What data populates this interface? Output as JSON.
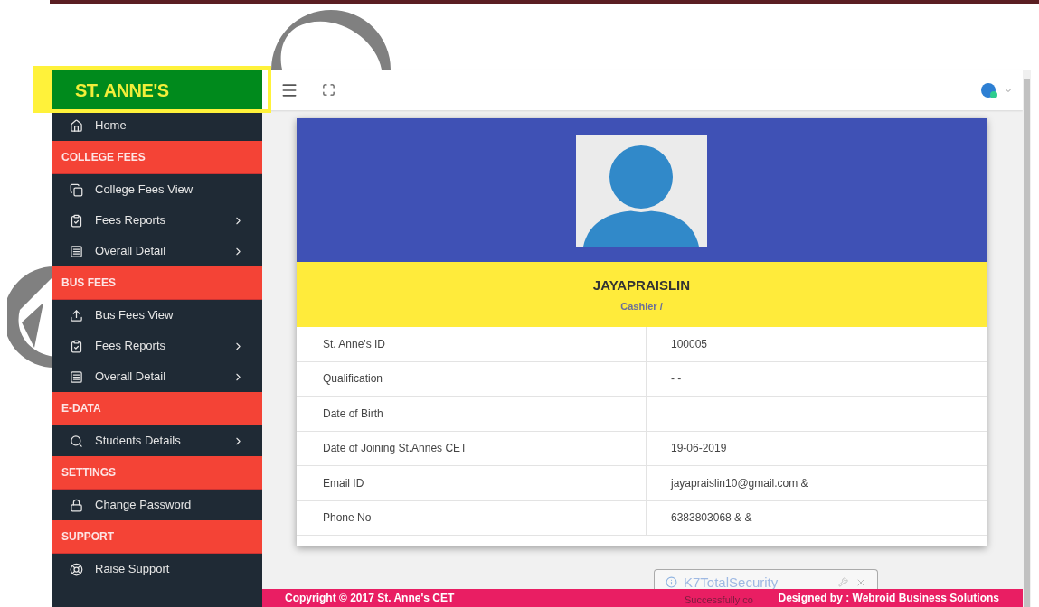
{
  "brand": {
    "logo": "ST. ANNE'S"
  },
  "sidebar": {
    "items": [
      {
        "kind": "link",
        "label": "Home",
        "arrow": false
      },
      {
        "kind": "header",
        "label": "COLLEGE FEES"
      },
      {
        "kind": "link",
        "label": "College Fees View",
        "arrow": false
      },
      {
        "kind": "link",
        "label": "Fees Reports",
        "arrow": true
      },
      {
        "kind": "link",
        "label": "Overall Detail",
        "arrow": true
      },
      {
        "kind": "header",
        "label": "BUS FEES"
      },
      {
        "kind": "link",
        "label": "Bus Fees View",
        "arrow": false
      },
      {
        "kind": "link",
        "label": "Fees Reports",
        "arrow": true
      },
      {
        "kind": "link",
        "label": "Overall Detail",
        "arrow": true
      },
      {
        "kind": "header",
        "label": "E-DATA"
      },
      {
        "kind": "link",
        "label": "Students Details",
        "arrow": true
      },
      {
        "kind": "header",
        "label": "SETTINGS"
      },
      {
        "kind": "link",
        "label": "Change Password",
        "arrow": false
      },
      {
        "kind": "header",
        "label": "SUPPORT"
      },
      {
        "kind": "link",
        "label": "Raise Support",
        "arrow": false
      }
    ]
  },
  "profile": {
    "name": "JAYAPRAISLIN",
    "role": "Cashier /",
    "rows": [
      {
        "label": "St. Anne's ID",
        "value": "100005"
      },
      {
        "label": "Qualification",
        "value": "- -"
      },
      {
        "label": "Date of Birth"
      },
      {
        "label": "Date of Joining St.Annes CET",
        "value": "19-06-2019"
      },
      {
        "label": "Email ID",
        "value": "jayapraislin10@gmail.com &"
      },
      {
        "label": "Phone No",
        "value": "6383803068 & &"
      }
    ]
  },
  "footer": {
    "copyright": "Copyright © 2017 St. Anne's CET",
    "credit": "Designed by : Webroid Business Solutions"
  },
  "notification": {
    "title": "K7TotalSecurity",
    "message": "Successfully co"
  }
}
